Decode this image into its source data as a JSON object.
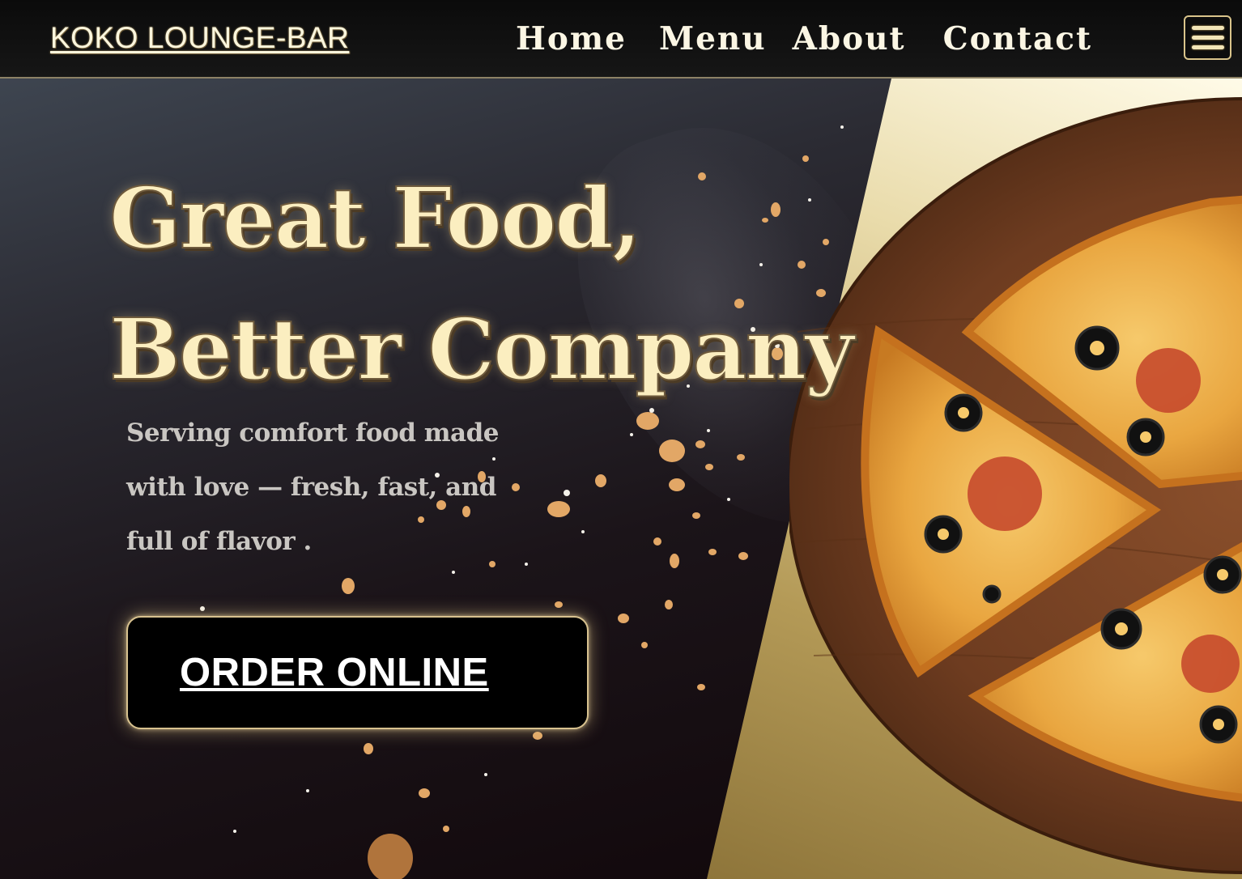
{
  "brand": {
    "name": "KOKO LOUNGE-BAR"
  },
  "nav": {
    "links": [
      {
        "label": "Home"
      },
      {
        "label": "Menu"
      },
      {
        "label": "About"
      },
      {
        "label": "Contact"
      }
    ],
    "menu_icon": "hamburger-icon"
  },
  "hero": {
    "title_line1": "Great Food,",
    "title_line2": "Better Company",
    "subtitle_line1": "Serving comfort food made",
    "subtitle_line2": "with love — fresh, fast, and",
    "subtitle_line3": "full of flavor .",
    "cta_label": "ORDER ONLINE",
    "image": "pizza-on-wooden-board"
  },
  "colors": {
    "nav_bg": "#111111",
    "accent_gold": "#d8c28f",
    "title_cream": "#fbeec0",
    "subtitle_gray": "#c9c6c2",
    "cta_bg": "#000000"
  }
}
